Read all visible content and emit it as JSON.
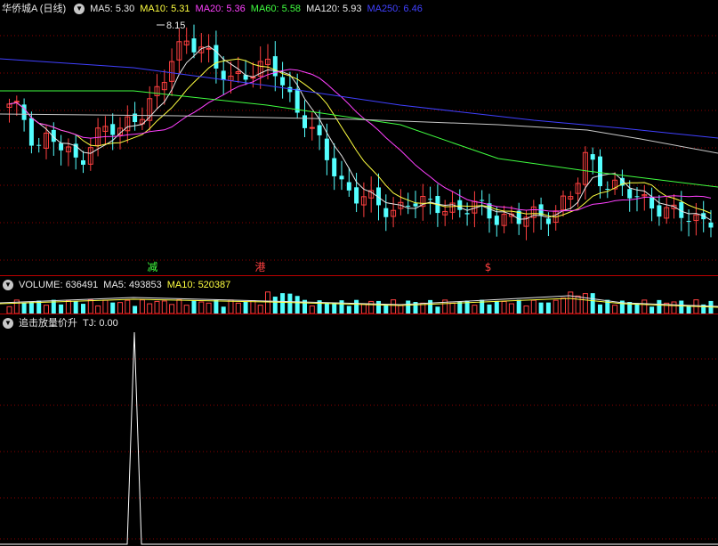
{
  "title": "华侨城A (日线)",
  "colors": {
    "up": "#ff4040",
    "down": "#54ffff",
    "ma5": "#e8e8e8",
    "ma10": "#ffff40",
    "ma20": "#ff40ff",
    "ma60": "#40ff40",
    "ma120": "#c8c8c8",
    "ma250": "#4040ff",
    "grid": "#8b0000"
  },
  "price_header": [
    {
      "label": "MA5: 5.30",
      "color": "#e8e8e8"
    },
    {
      "label": "MA10: 5.31",
      "color": "#ffff40"
    },
    {
      "label": "MA20: 5.36",
      "color": "#ff40ff"
    },
    {
      "label": "MA60: 5.58",
      "color": "#40ff40"
    },
    {
      "label": "MA120: 5.93",
      "color": "#e8e8e8"
    },
    {
      "label": "MA250: 6.46",
      "color": "#4040ff"
    }
  ],
  "peak_label": "8.15",
  "markers": [
    {
      "text": "减",
      "color": "#40ff40",
      "x": 0.205
    },
    {
      "text": "港",
      "color": "#ff4040",
      "x": 0.355
    },
    {
      "text": "$",
      "color": "#ff4040",
      "x": 0.675
    }
  ],
  "volume_header": [
    {
      "label": "VOLUME: 636491",
      "color": "#e8e8e8"
    },
    {
      "label": "MA5: 493853",
      "color": "#e8e8e8"
    },
    {
      "label": "MA10: 520387",
      "color": "#ffff40"
    }
  ],
  "indicator_header": [
    {
      "label": "追击放量价升",
      "color": "#e8e8e8"
    },
    {
      "label": "TJ: 0.00",
      "color": "#e8e8e8"
    }
  ],
  "chart_data": [
    {
      "type": "candlestick",
      "title": "华侨城A (日线)",
      "close_path": [
        7.0,
        6.9,
        6.4,
        6.6,
        6.3,
        6.2,
        6.5,
        6.7,
        6.6,
        6.9,
        7.0,
        7.3,
        7.8,
        8.1,
        7.9,
        7.6,
        7.4,
        7.6,
        7.5,
        7.7,
        7.3,
        7.0,
        6.6,
        6.3,
        5.9,
        5.7,
        5.6,
        5.5,
        5.45,
        5.6,
        5.5,
        5.55,
        5.5,
        5.45,
        5.5,
        5.4,
        5.35,
        5.3,
        5.35,
        5.4,
        5.5,
        5.7,
        6.3,
        5.95,
        5.8,
        5.7,
        5.6,
        5.55,
        5.4,
        5.35,
        5.3,
        5.35
      ],
      "series": [
        {
          "name": "MA5",
          "values": [
            5.3
          ]
        },
        {
          "name": "MA10",
          "values": [
            5.31
          ]
        },
        {
          "name": "MA20",
          "values": [
            5.36
          ]
        },
        {
          "name": "MA60",
          "values": [
            5.58
          ]
        },
        {
          "name": "MA120",
          "values": [
            5.93
          ]
        },
        {
          "name": "MA250",
          "values": [
            6.46
          ]
        }
      ],
      "annotations": [
        "8.15"
      ]
    },
    {
      "type": "bar",
      "series": [
        {
          "name": "VOLUME",
          "values": [
            636491
          ]
        },
        {
          "name": "MA5",
          "values": [
            493853
          ]
        },
        {
          "name": "MA10",
          "values": [
            520387
          ]
        }
      ]
    },
    {
      "type": "line",
      "series": [
        {
          "name": "TJ",
          "values": [
            0.0
          ]
        }
      ]
    }
  ]
}
